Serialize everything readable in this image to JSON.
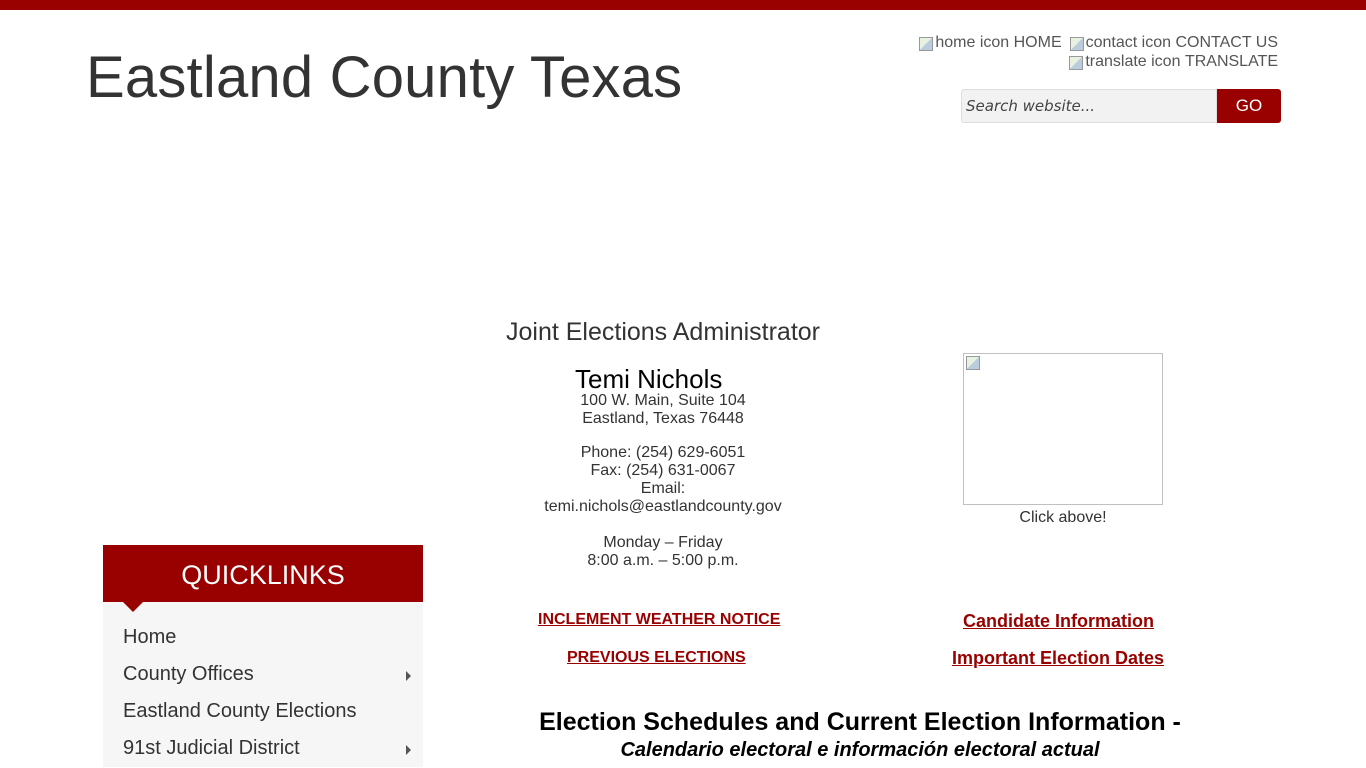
{
  "header": {
    "site_title": "Eastland County Texas",
    "util_links": [
      {
        "icon_alt": "home icon",
        "label": "HOME"
      },
      {
        "icon_alt": "contact icon",
        "label": "CONTACT US"
      },
      {
        "icon_alt": "translate icon",
        "label": "TRANSLATE"
      }
    ],
    "search": {
      "placeholder": "Search website...",
      "button_label": "GO"
    }
  },
  "main": {
    "section_title": "Joint Elections Administrator",
    "admin_name": "Temi Nichols",
    "address_line1": "100 W. Main, Suite 104",
    "address_line2": "Eastland, Texas 76448",
    "phone": "Phone: (254) 629-6051",
    "fax": "Fax: (254) 631-0067",
    "email_label": "Email:",
    "email": "temi.nichols@eastlandcounty.gov",
    "hours_days": "Monday – Friday",
    "hours_time": "8:00 a.m. – 5:00 p.m.",
    "promo_caption": "Click above!",
    "links": {
      "weather": "INCLEMENT WEATHER NOTICE",
      "previous": "PREVIOUS ELECTIONS",
      "candidate": "Candidate Information",
      "dates": "Important Election Dates"
    },
    "schedule_title": "Election Schedules and Current Election Information -",
    "schedule_subtitle": "Calendario electoral e información electoral actual"
  },
  "quicklinks": {
    "title": "QUICKLINKS",
    "items": [
      {
        "label": "Home",
        "has_submenu": false
      },
      {
        "label": "County Offices",
        "has_submenu": true
      },
      {
        "label": "Eastland County Elections",
        "has_submenu": false
      },
      {
        "label": "91st Judicial District",
        "has_submenu": true
      }
    ]
  },
  "colors": {
    "accent": "#990000",
    "text": "#333333"
  }
}
